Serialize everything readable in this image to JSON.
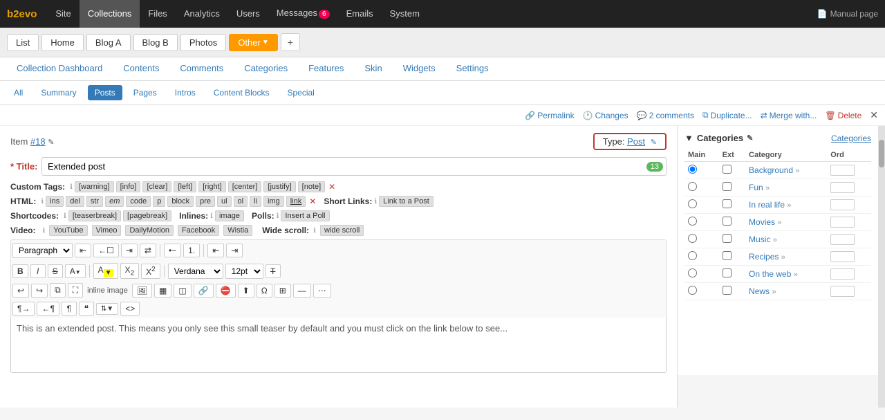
{
  "brand": "b2evo",
  "topNav": {
    "items": [
      {
        "label": "Site",
        "active": false
      },
      {
        "label": "Collections",
        "active": true
      },
      {
        "label": "Files",
        "active": false
      },
      {
        "label": "Analytics",
        "active": false
      },
      {
        "label": "Users",
        "active": false
      },
      {
        "label": "Messages",
        "active": false,
        "badge": "6"
      },
      {
        "label": "Emails",
        "active": false
      },
      {
        "label": "System",
        "active": false
      }
    ],
    "manual": "Manual page"
  },
  "secondBar": {
    "tabs": [
      {
        "label": "List",
        "active": false
      },
      {
        "label": "Home",
        "active": false
      },
      {
        "label": "Blog A",
        "active": false
      },
      {
        "label": "Blog B",
        "active": false
      },
      {
        "label": "Photos",
        "active": false
      },
      {
        "label": "Other",
        "active": true,
        "hasDropdown": true
      }
    ],
    "addBtn": "+"
  },
  "subTabs": [
    {
      "label": "Collection Dashboard",
      "active": false
    },
    {
      "label": "Contents",
      "active": false
    },
    {
      "label": "Comments",
      "active": false
    },
    {
      "label": "Categories",
      "active": false
    },
    {
      "label": "Features",
      "active": false
    },
    {
      "label": "Skin",
      "active": false
    },
    {
      "label": "Widgets",
      "active": false
    },
    {
      "label": "Settings",
      "active": false
    }
  ],
  "filterBar": {
    "items": [
      {
        "label": "All",
        "active": false
      },
      {
        "label": "Summary",
        "active": false
      },
      {
        "label": "Posts",
        "active": true
      },
      {
        "label": "Pages",
        "active": false
      },
      {
        "label": "Intros",
        "active": false
      },
      {
        "label": "Content Blocks",
        "active": false
      },
      {
        "label": "Special",
        "active": false
      }
    ]
  },
  "actionBar": {
    "permalink": "Permalink",
    "changes": "Changes",
    "comments": "2 comments",
    "duplicate": "Duplicate...",
    "mergeWith": "Merge with...",
    "delete": "Delete"
  },
  "editor": {
    "itemLabel": "Item",
    "itemNumber": "#18",
    "typeLabel": "Type:",
    "typeValue": "Post",
    "titleLabel": "* Title:",
    "titleValue": "Extended post",
    "charCount": "13",
    "customTagsLabel": "Custom Tags:",
    "customTags": [
      "[warning]",
      "[info]",
      "[clear]",
      "[left]",
      "[right]",
      "[center]",
      "[justify]",
      "[note]"
    ],
    "htmlLabel": "HTML:",
    "htmlTags": [
      "ins",
      "del",
      "str",
      "em",
      "code",
      "p",
      "block",
      "pre",
      "ul",
      "ol",
      "li",
      "img",
      "link"
    ],
    "shortLinksLabel": "Short Links:",
    "shortLinkBtn": "Link to a Post",
    "shortcodesLabel": "Shortcodes:",
    "shortcodeTags": [
      "[teaserbreak]",
      "[pagebreak]"
    ],
    "inlinesLabel": "Inlines:",
    "inlineTags": [
      "image"
    ],
    "pollsLabel": "Polls:",
    "pollBtn": "Insert a Poll",
    "videoLabel": "Video:",
    "videoItems": [
      "YouTube",
      "Vimeo",
      "DailyMotion",
      "Facebook",
      "Wistia"
    ],
    "wideScrollLabel": "Wide scroll:",
    "wideScrollBtn": "wide scroll",
    "paragraphSelect": "Paragraph",
    "fontSelect": "Verdana",
    "sizeSelect": "12pt",
    "editorContent": "This is an extended post. This means you only see this small teaser by default and you must click on the link below to see..."
  },
  "categories": {
    "title": "Categories",
    "editLabel": "Categories",
    "colMain": "Main",
    "colExt": "Ext",
    "colCategory": "Category",
    "colOrd": "Ord",
    "items": [
      {
        "name": "Background",
        "main": true,
        "ext": false,
        "ord": ""
      },
      {
        "name": "Fun",
        "main": false,
        "ext": false,
        "ord": ""
      },
      {
        "name": "In real life",
        "main": false,
        "ext": false,
        "ord": ""
      },
      {
        "name": "Movies",
        "main": false,
        "ext": false,
        "ord": ""
      },
      {
        "name": "Music",
        "main": false,
        "ext": false,
        "ord": ""
      },
      {
        "name": "Recipes",
        "main": false,
        "ext": false,
        "ord": ""
      },
      {
        "name": "On the web",
        "main": false,
        "ext": false,
        "ord": ""
      },
      {
        "name": "News",
        "main": false,
        "ext": false,
        "ord": ""
      }
    ]
  }
}
